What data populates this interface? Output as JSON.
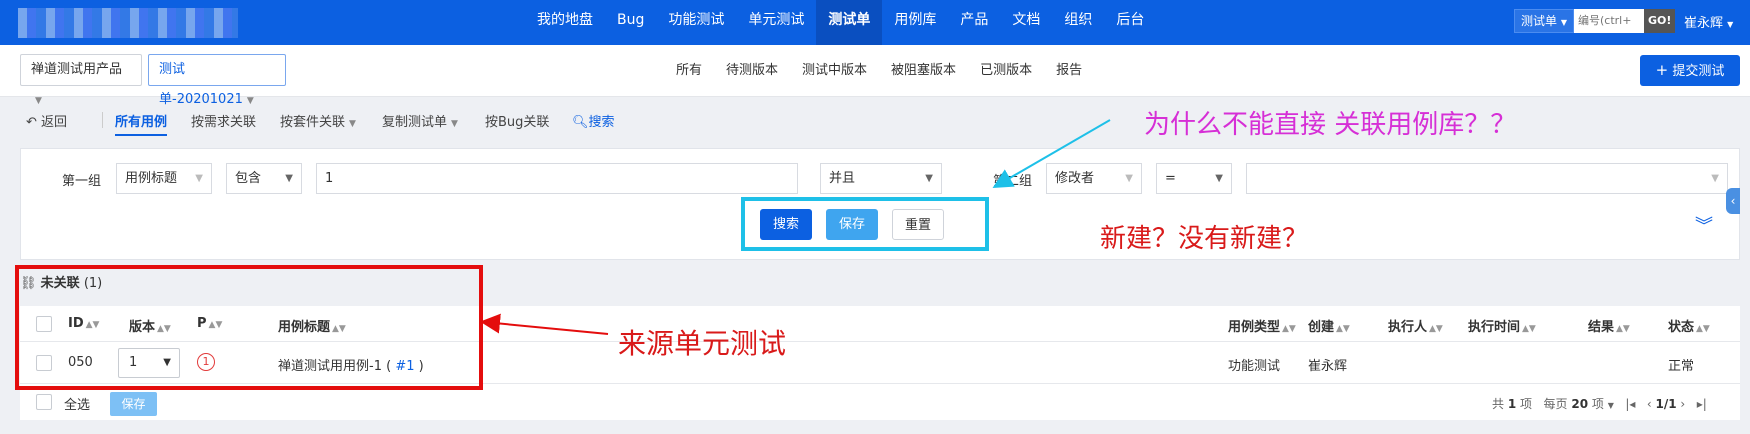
{
  "topbar": {
    "nav": [
      "我的地盘",
      "Bug",
      "功能测试",
      "单元测试",
      "测试单",
      "用例库",
      "产品",
      "文档",
      "组织",
      "后台"
    ],
    "active_index": 4,
    "search_type": "测试单",
    "search_placeholder": "编号(ctrl+",
    "go_label": "GO!",
    "user": "崔永辉"
  },
  "subbar": {
    "product": "禅道测试用产品",
    "testtask": "测试单-20201021",
    "tabs": [
      "所有",
      "待测版本",
      "测试中版本",
      "被阻塞版本",
      "已测版本",
      "报告"
    ],
    "submit_label": "提交测试"
  },
  "toolbar": {
    "back": "返回",
    "all_cases": "所有用例",
    "by_story": "按需求关联",
    "by_suite": "按套件关联",
    "copy_testtask": "复制测试单",
    "by_bug": "按Bug关联",
    "search": "搜索"
  },
  "search": {
    "group1_label": "第一组",
    "field1": "用例标题",
    "op1": "包含",
    "value1": "1",
    "andor": "并且",
    "group2_label": "第二组",
    "field2": "修改者",
    "op2": "=",
    "value2": "",
    "search_button": "搜索",
    "save_button": "保存",
    "reset_button": "重置"
  },
  "section": {
    "title": "未关联",
    "count": "(1)"
  },
  "table": {
    "headers": {
      "id": "ID",
      "version": "版本",
      "pri": "P",
      "title": "用例标题",
      "type": "用例类型",
      "creator": "创建",
      "executor": "执行人",
      "exec_time": "执行时间",
      "result": "结果",
      "status": "状态"
    },
    "rows": [
      {
        "id": "050",
        "version": "1",
        "pri": "1",
        "title": "禅道测试用用例-1 (",
        "title_link": "#1",
        "title_end": ")",
        "type": "功能测试",
        "creator": "崔永辉",
        "executor": "",
        "exec_time": "",
        "result": "",
        "status": "正常"
      }
    ]
  },
  "footer": {
    "select_all": "全选",
    "save": "保存",
    "total_prefix": "共",
    "total": "1",
    "total_suffix": "项",
    "per_page_prefix": "每页",
    "per_page": "20",
    "per_page_suffix": "项",
    "page": "1/1"
  },
  "annotations": {
    "question1": "为什么不能直接 关联用例库？？",
    "question2": "新建？没有新建？",
    "note": "来源单元测试"
  },
  "colors": {
    "brand": "#0c60e1",
    "annotation_magenta": "#d62fd6",
    "annotation_red": "#d91a1a",
    "highlight_cyan": "#1ec0e8",
    "highlight_red": "#e40d0d"
  }
}
